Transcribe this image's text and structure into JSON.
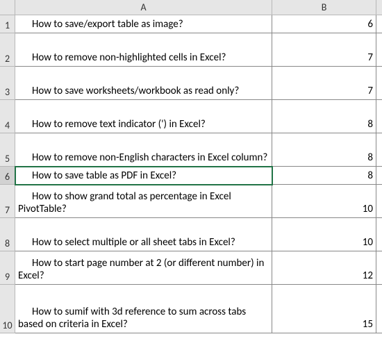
{
  "columns": {
    "A": "A",
    "B": "B"
  },
  "rows": [
    {
      "n": "1",
      "a": "How to save/export table as image?",
      "b": "6"
    },
    {
      "n": "2",
      "a": "How to remove non-highlighted cells in Excel?",
      "b": "7"
    },
    {
      "n": "3",
      "a": "How to save worksheets/workbook as read only?",
      "b": "7"
    },
    {
      "n": "4",
      "a": "How to remove text indicator (') in Excel?",
      "b": "8"
    },
    {
      "n": "5",
      "a": "How to remove non-English characters in Excel column?",
      "b": "8"
    },
    {
      "n": "6",
      "a": "How to save table as PDF in Excel?",
      "b": "8"
    },
    {
      "n": "7",
      "a": "How to show grand total as percentage in Excel PivotTable?",
      "b": "10"
    },
    {
      "n": "8",
      "a": "How to select multiple or all sheet tabs in Excel?",
      "b": "10"
    },
    {
      "n": "9",
      "a": "How to start page number at 2 (or different number) in Excel?",
      "b": "12"
    },
    {
      "n": "10",
      "a": "How to sumif with 3d reference to sum across tabs based on criteria in Excel?",
      "b": "15"
    }
  ],
  "active_cell": "A6",
  "chart_data": {
    "type": "table",
    "columns": [
      "A",
      "B"
    ],
    "rows": [
      [
        "How to save/export table as image?",
        6
      ],
      [
        "How to remove non-highlighted cells in Excel?",
        7
      ],
      [
        "How to save worksheets/workbook as read only?",
        7
      ],
      [
        "How to remove text indicator (') in Excel?",
        8
      ],
      [
        "How to remove non-English characters in Excel column?",
        8
      ],
      [
        "How to save table as PDF in Excel?",
        8
      ],
      [
        "How to show grand total as percentage in Excel PivotTable?",
        10
      ],
      [
        "How to select multiple or all sheet tabs in Excel?",
        10
      ],
      [
        "How to start page number at 2 (or different number) in Excel?",
        12
      ],
      [
        "How to sumif with 3d reference to sum across tabs based on criteria in Excel?",
        15
      ]
    ]
  }
}
